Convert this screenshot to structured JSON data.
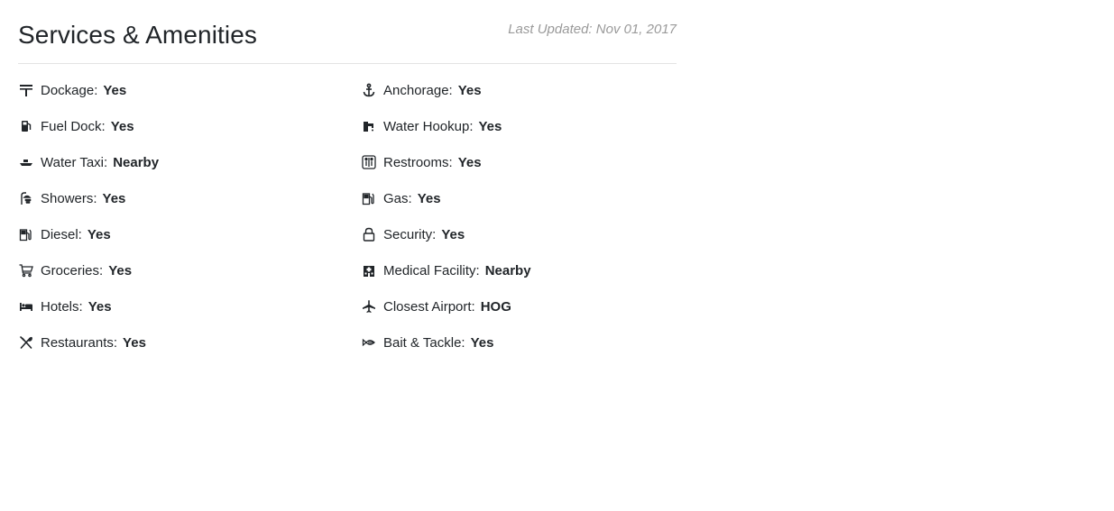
{
  "header": {
    "title": "Services & Amenities",
    "last_updated": "Last Updated: Nov 01, 2017"
  },
  "amenities": [
    {
      "icon": "dockage-icon",
      "label": "Dockage:",
      "value": "Yes"
    },
    {
      "icon": "anchor-icon",
      "label": "Anchorage:",
      "value": "Yes"
    },
    {
      "icon": "fuel-pump-icon",
      "label": "Fuel Dock:",
      "value": "Yes"
    },
    {
      "icon": "water-faucet-icon",
      "label": "Water Hookup:",
      "value": "Yes"
    },
    {
      "icon": "boat-icon",
      "label": "Water Taxi:",
      "value": "Nearby"
    },
    {
      "icon": "restroom-icon",
      "label": "Restrooms:",
      "value": "Yes"
    },
    {
      "icon": "shower-icon",
      "label": "Showers:",
      "value": "Yes"
    },
    {
      "icon": "gas-pump-icon",
      "label": "Gas:",
      "value": "Yes"
    },
    {
      "icon": "diesel-pump-icon",
      "label": "Diesel:",
      "value": "Yes"
    },
    {
      "icon": "lock-icon",
      "label": "Security:",
      "value": "Yes"
    },
    {
      "icon": "shopping-cart-icon",
      "label": "Groceries:",
      "value": "Yes"
    },
    {
      "icon": "hospital-icon",
      "label": "Medical Facility:",
      "value": "Nearby"
    },
    {
      "icon": "bed-icon",
      "label": "Hotels:",
      "value": "Yes"
    },
    {
      "icon": "airplane-icon",
      "label": "Closest Airport:",
      "value": "HOG"
    },
    {
      "icon": "utensils-icon",
      "label": "Restaurants:",
      "value": "Yes"
    },
    {
      "icon": "fish-icon",
      "label": "Bait & Tackle:",
      "value": "Yes"
    }
  ]
}
